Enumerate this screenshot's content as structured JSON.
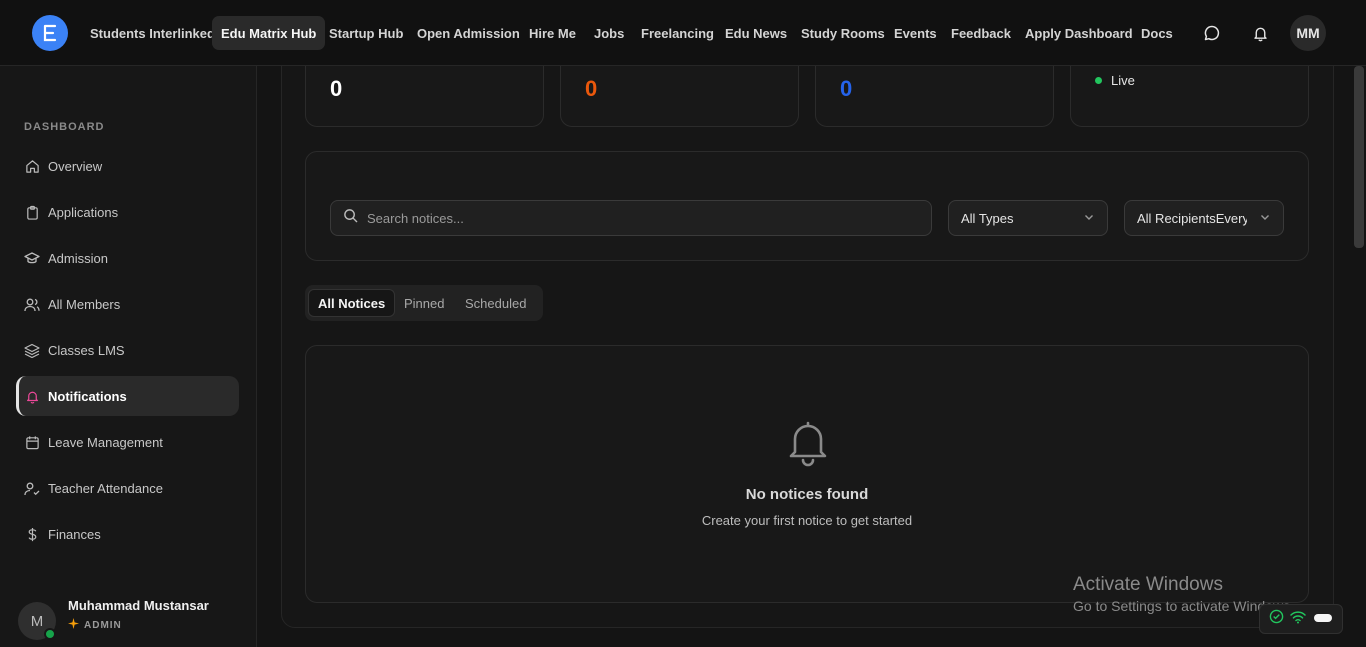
{
  "topnav": {
    "items": [
      "Students Interlinked",
      "Edu Matrix Hub",
      "Startup Hub",
      "Open Admission",
      "Hire Me",
      "Jobs",
      "Freelancing",
      "Edu News",
      "Study Rooms",
      "Events",
      "Feedback",
      "Apply Dashboard",
      "Docs"
    ],
    "active_item": "Edu Matrix Hub",
    "avatar_initials": "MM",
    "icons": [
      "chat-icon",
      "bell-icon"
    ]
  },
  "sidebar": {
    "section": "DASHBOARD",
    "items": [
      {
        "label": "Overview",
        "icon": "home-icon"
      },
      {
        "label": "Applications",
        "icon": "clipboard-icon"
      },
      {
        "label": "Admission",
        "icon": "graduation-cap-icon"
      },
      {
        "label": "All Members",
        "icon": "users-icon"
      },
      {
        "label": "Classes LMS",
        "icon": "layers-icon"
      },
      {
        "label": "Notifications",
        "icon": "bell-icon"
      },
      {
        "label": "Leave Management",
        "icon": "calendar-icon"
      },
      {
        "label": "Teacher Attendance",
        "icon": "user-check-icon"
      },
      {
        "label": "Finances",
        "icon": "dollar-icon"
      }
    ],
    "active_item": "Notifications",
    "user": {
      "initial": "M",
      "name": "Muhammad Mustansar",
      "role": "ADMIN"
    }
  },
  "stats": [
    {
      "value": "0",
      "color": "#ffffff"
    },
    {
      "value": "0",
      "color": "#ea580c"
    },
    {
      "value": "0",
      "color": "#2563eb"
    },
    {
      "status": "Live",
      "color": "#22c55e"
    }
  ],
  "filters": {
    "search_placeholder": "Search notices...",
    "type_select": "All Types",
    "recipients_select": "All RecipientsEveryone"
  },
  "tabs": [
    "All Notices",
    "Pinned",
    "Scheduled"
  ],
  "active_tab": "All Notices",
  "empty_state": {
    "title": "No notices found",
    "subtitle": "Create your first notice to get started"
  },
  "watermark": {
    "title": "Activate Windows",
    "subtitle": "Go to Settings to activate Windows."
  },
  "accent_color": "#3b82f6"
}
